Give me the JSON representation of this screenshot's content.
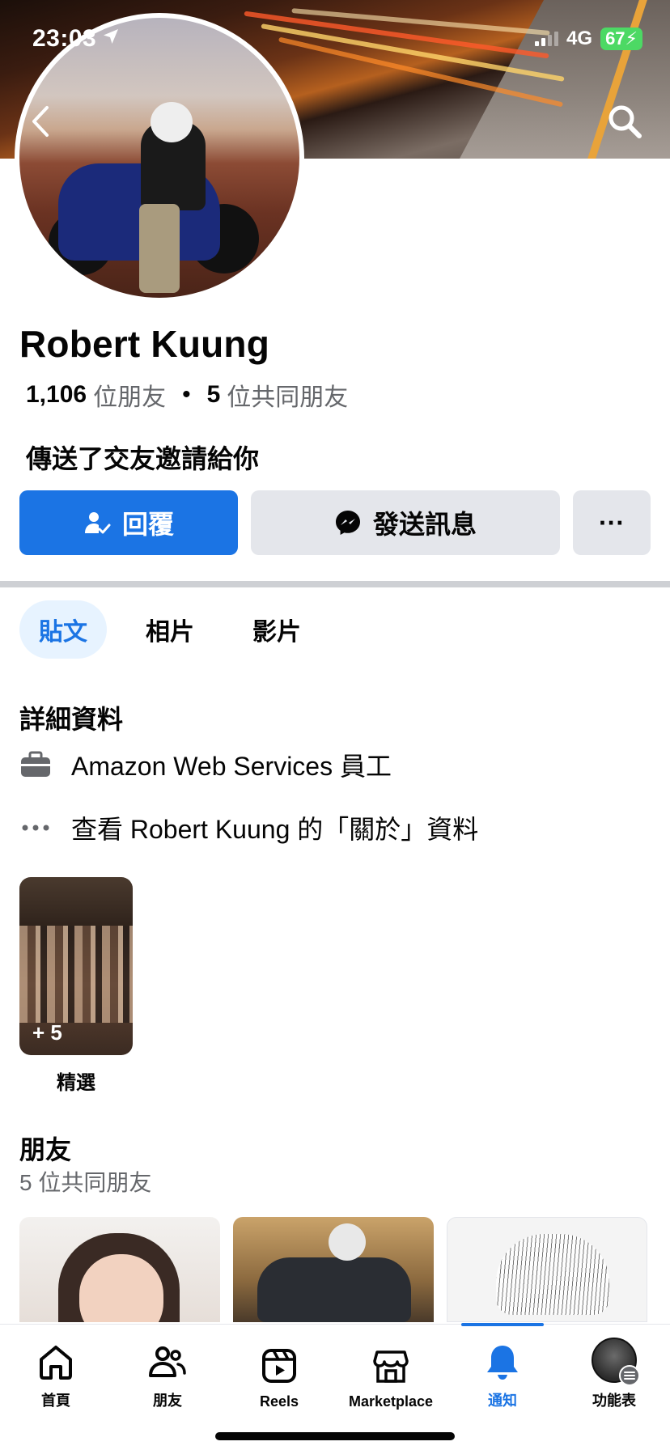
{
  "status_bar": {
    "time": "23:03",
    "network": "4G",
    "battery": "67"
  },
  "profile": {
    "name": "Robert Kuung",
    "friend_count": "1,106",
    "friend_count_suffix": "位朋友",
    "separator": "•",
    "mutual_count": "5",
    "mutual_suffix": "位共同朋友",
    "request_text": "傳送了交友邀請給你"
  },
  "actions": {
    "reply_label": "回覆",
    "message_label": "發送訊息",
    "more_label": "···"
  },
  "tabs": [
    {
      "label": "貼文",
      "active": true
    },
    {
      "label": "相片",
      "active": false
    },
    {
      "label": "影片",
      "active": false
    }
  ],
  "details": {
    "title": "詳細資料",
    "work": "Amazon Web Services 員工",
    "about_link": "查看 Robert Kuung 的「關於」資料"
  },
  "featured": {
    "count": "+ 5",
    "label": "精選"
  },
  "friends": {
    "title": "朋友",
    "subtitle": "5 位共同朋友"
  },
  "bottom_nav": [
    {
      "label": "首頁",
      "icon": "home-icon"
    },
    {
      "label": "朋友",
      "icon": "friends-icon"
    },
    {
      "label": "Reels",
      "icon": "reels-icon"
    },
    {
      "label": "Marketplace",
      "icon": "marketplace-icon"
    },
    {
      "label": "通知",
      "icon": "bell-icon",
      "active": true
    },
    {
      "label": "功能表",
      "icon": "menu-avatar"
    }
  ],
  "colors": {
    "accent": "#1b74e4",
    "secondary_button": "#e4e6eb",
    "active_tab_bg": "#e7f3ff",
    "muted_text": "#65676b"
  }
}
